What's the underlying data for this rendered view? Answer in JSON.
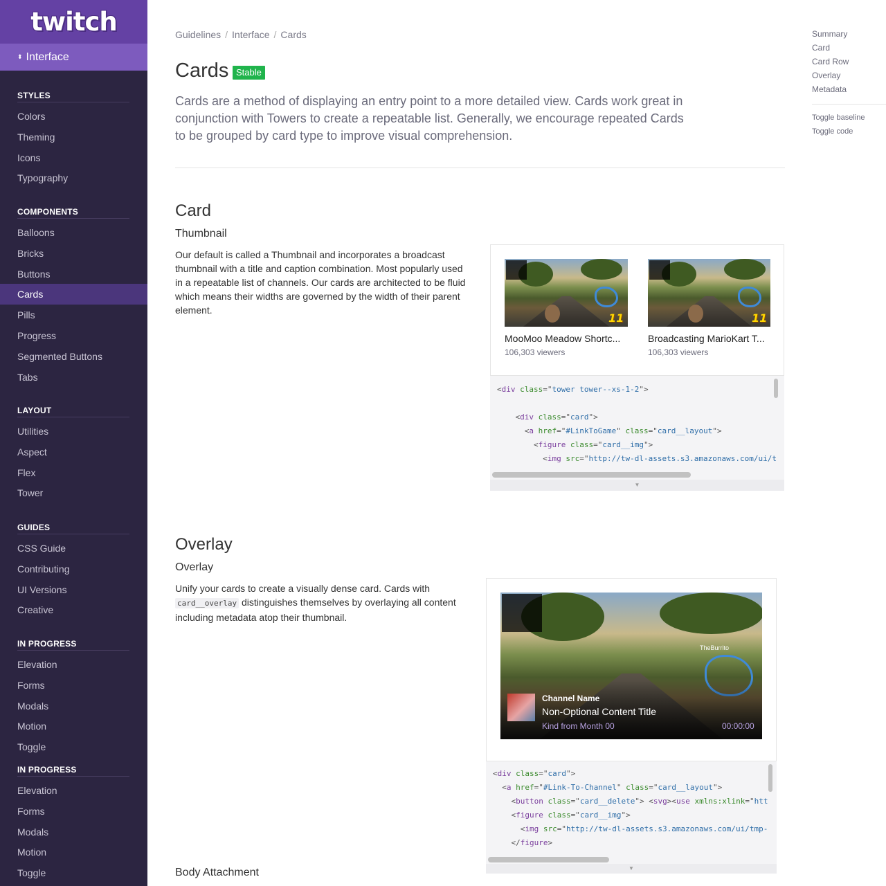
{
  "brand": {
    "logo": "twitch"
  },
  "section_switcher": {
    "label": "Interface"
  },
  "nav": {
    "groups": [
      {
        "heading": "STYLES",
        "items": [
          "Colors",
          "Theming",
          "Icons",
          "Typography"
        ]
      },
      {
        "heading": "COMPONENTS",
        "items": [
          "Balloons",
          "Bricks",
          "Buttons",
          "Cards",
          "Pills",
          "Progress",
          "Segmented Buttons",
          "Tabs"
        ]
      },
      {
        "heading": "LAYOUT",
        "items": [
          "Utilities",
          "Aspect",
          "Flex",
          "Tower"
        ]
      },
      {
        "heading": "GUIDES",
        "items": [
          "CSS Guide",
          "Contributing",
          "UI Versions",
          "Creative"
        ]
      },
      {
        "heading": "IN PROGRESS",
        "items": [
          "Elevation",
          "Forms",
          "Modals",
          "Motion",
          "Toggle"
        ]
      },
      {
        "heading": "IN PROGRESS",
        "items": [
          "Elevation",
          "Forms",
          "Modals",
          "Motion",
          "Toggle"
        ]
      }
    ],
    "active": "Cards"
  },
  "breadcrumb": [
    "Guidelines",
    "Interface",
    "Cards"
  ],
  "page": {
    "title": "Cards",
    "badge": "Stable",
    "intro": "Cards are a method of displaying an entry point to a more detailed view. Cards work great in conjunction with Towers to create a repeatable list. Generally, we encourage repeated Cards to be grouped by card type to improve visual comprehension."
  },
  "card_section": {
    "title": "Card",
    "subtitle": "Thumbnail",
    "description": "Our default is called a Thumbnail and incorporates a broadcast thumbnail with a title and caption combination. Most popularly used in a repeatable list of channels. Our cards are architected to be fluid which means their widths are governed by the width of their parent element.",
    "cards": [
      {
        "title": "MooMoo Meadow Shortc...",
        "meta": "106,303 viewers",
        "rank": "11"
      },
      {
        "title": "Broadcasting MarioKart T...",
        "meta": "106,303 viewers",
        "rank": "11"
      }
    ],
    "code": [
      [
        {
          "t": "pl",
          "v": "<"
        },
        {
          "t": "tg",
          "v": "div"
        },
        {
          "t": "pl",
          "v": " "
        },
        {
          "t": "at",
          "v": "class"
        },
        {
          "t": "pl",
          "v": "=\""
        },
        {
          "t": "st",
          "v": "tower tower--xs-1-2"
        },
        {
          "t": "pl",
          "v": "\">"
        }
      ],
      [],
      [
        {
          "t": "pl",
          "v": "    <"
        },
        {
          "t": "tg",
          "v": "div"
        },
        {
          "t": "pl",
          "v": " "
        },
        {
          "t": "at",
          "v": "class"
        },
        {
          "t": "pl",
          "v": "=\""
        },
        {
          "t": "st",
          "v": "card"
        },
        {
          "t": "pl",
          "v": "\">"
        }
      ],
      [
        {
          "t": "pl",
          "v": "      <"
        },
        {
          "t": "tg",
          "v": "a"
        },
        {
          "t": "pl",
          "v": " "
        },
        {
          "t": "at",
          "v": "href"
        },
        {
          "t": "pl",
          "v": "=\""
        },
        {
          "t": "st",
          "v": "#LinkToGame"
        },
        {
          "t": "pl",
          "v": "\" "
        },
        {
          "t": "at",
          "v": "class"
        },
        {
          "t": "pl",
          "v": "=\""
        },
        {
          "t": "st",
          "v": "card__layout"
        },
        {
          "t": "pl",
          "v": "\">"
        }
      ],
      [
        {
          "t": "pl",
          "v": "        <"
        },
        {
          "t": "tg",
          "v": "figure"
        },
        {
          "t": "pl",
          "v": " "
        },
        {
          "t": "at",
          "v": "class"
        },
        {
          "t": "pl",
          "v": "=\""
        },
        {
          "t": "st",
          "v": "card__img"
        },
        {
          "t": "pl",
          "v": "\">"
        }
      ],
      [
        {
          "t": "pl",
          "v": "          <"
        },
        {
          "t": "tg",
          "v": "img"
        },
        {
          "t": "pl",
          "v": " "
        },
        {
          "t": "at",
          "v": "src"
        },
        {
          "t": "pl",
          "v": "=\""
        },
        {
          "t": "st",
          "v": "http://tw-dl-assets.s3.amazonaws.com/ui/t"
        }
      ]
    ]
  },
  "overlay_section": {
    "title": "Overlay",
    "subtitle": "Overlay",
    "description_before": "Unify your cards to create a visually dense card. Cards with",
    "description_code": "card__overlay",
    "description_after": "distinguishes themselves by overlaying all content including metadata atop their thumbnail.",
    "overlay_card": {
      "channel": "Channel Name",
      "title": "Non-Optional Content Title",
      "kind": "Kind from Month 00",
      "time": "00:00:00",
      "player_tag": "TheBurrito"
    },
    "code": [
      [
        {
          "t": "pl",
          "v": "<"
        },
        {
          "t": "tg",
          "v": "div"
        },
        {
          "t": "pl",
          "v": " "
        },
        {
          "t": "at",
          "v": "class"
        },
        {
          "t": "pl",
          "v": "=\""
        },
        {
          "t": "st",
          "v": "card"
        },
        {
          "t": "pl",
          "v": "\">"
        }
      ],
      [
        {
          "t": "pl",
          "v": "  <"
        },
        {
          "t": "tg",
          "v": "a"
        },
        {
          "t": "pl",
          "v": " "
        },
        {
          "t": "at",
          "v": "href"
        },
        {
          "t": "pl",
          "v": "=\""
        },
        {
          "t": "st",
          "v": "#Link-To-Channel"
        },
        {
          "t": "pl",
          "v": "\" "
        },
        {
          "t": "at",
          "v": "class"
        },
        {
          "t": "pl",
          "v": "=\""
        },
        {
          "t": "st",
          "v": "card__layout"
        },
        {
          "t": "pl",
          "v": "\">"
        }
      ],
      [
        {
          "t": "pl",
          "v": "    <"
        },
        {
          "t": "tg",
          "v": "button"
        },
        {
          "t": "pl",
          "v": " "
        },
        {
          "t": "at",
          "v": "class"
        },
        {
          "t": "pl",
          "v": "=\""
        },
        {
          "t": "st",
          "v": "card__delete"
        },
        {
          "t": "pl",
          "v": "\"> <"
        },
        {
          "t": "tg",
          "v": "svg"
        },
        {
          "t": "pl",
          "v": "><"
        },
        {
          "t": "tg",
          "v": "use"
        },
        {
          "t": "pl",
          "v": " "
        },
        {
          "t": "at",
          "v": "xmlns:xlink"
        },
        {
          "t": "pl",
          "v": "=\""
        },
        {
          "t": "st",
          "v": "htt"
        }
      ],
      [
        {
          "t": "pl",
          "v": "    <"
        },
        {
          "t": "tg",
          "v": "figure"
        },
        {
          "t": "pl",
          "v": " "
        },
        {
          "t": "at",
          "v": "class"
        },
        {
          "t": "pl",
          "v": "=\""
        },
        {
          "t": "st",
          "v": "card__img"
        },
        {
          "t": "pl",
          "v": "\">"
        }
      ],
      [
        {
          "t": "pl",
          "v": "      <"
        },
        {
          "t": "tg",
          "v": "img"
        },
        {
          "t": "pl",
          "v": " "
        },
        {
          "t": "at",
          "v": "src"
        },
        {
          "t": "pl",
          "v": "=\""
        },
        {
          "t": "st",
          "v": "http://tw-dl-assets.s3.amazonaws.com/ui/tmp-"
        }
      ],
      [
        {
          "t": "pl",
          "v": "    </"
        },
        {
          "t": "tg",
          "v": "figure"
        },
        {
          "t": "pl",
          "v": ">"
        }
      ]
    ]
  },
  "body_attachment": {
    "title": "Body Attachment"
  },
  "toc": {
    "sections": [
      "Summary",
      "Card",
      "Card Row",
      "Overlay",
      "Metadata"
    ],
    "actions": [
      "Toggle baseline",
      "Toggle code"
    ]
  },
  "colors": {
    "brand_purple": "#6441a4",
    "sidebar_bg": "#2c2541",
    "stable_green": "#20b44c"
  }
}
